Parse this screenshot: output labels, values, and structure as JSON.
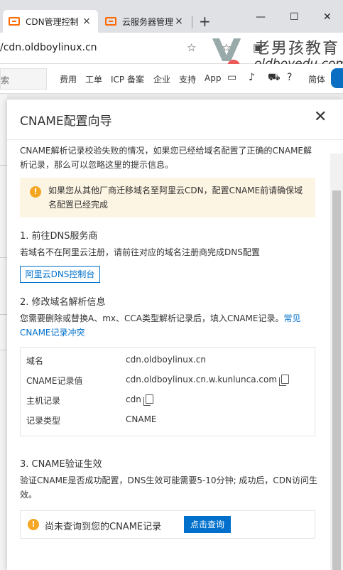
{
  "browser": {
    "tabs": [
      {
        "label": "CDN管理控制",
        "close": "×"
      },
      {
        "label": "云服务器管理",
        "close": "×"
      }
    ],
    "newtab": "+",
    "window_buttons": {
      "minimize": "—",
      "maximize": "☐",
      "close": "✕"
    },
    "url": "/cdn.oldboylinux.cn"
  },
  "watermark": {
    "title": "老男孩教育",
    "subtitle": "oldboyedu.com"
  },
  "site_nav": {
    "search_stub": "索",
    "items": [
      "费用",
      "工单",
      "ICP 备案",
      "企业",
      "支持",
      "App"
    ],
    "lang": "简体"
  },
  "drawer": {
    "title": "CNAME配置向导",
    "close": "✕",
    "intro": "CNAME解析记录校验失败的情况，如果您已经给域名配置了正确的CNAME解析记录，那么可以忽略这里的提示信息。",
    "notice": "如果您从其他厂商迁移域名至阿里云CDN，配置CNAME前请确保域名配置已经完成",
    "step1": {
      "title": "1. 前往DNS服务商",
      "desc": "若域名不在阿里云注册，请前往对应的域名注册商完成DNS配置",
      "button": "阿里云DNS控制台"
    },
    "step2": {
      "title": "2. 修改域名解析信息",
      "desc": "您需要删除或替换A、mx、CCA类型解析记录后，填入CNAME记录。",
      "link": "常见CNAME记录冲突",
      "rows": [
        {
          "key": "域名",
          "value": "cdn.oldboylinux.cn"
        },
        {
          "key": "CNAME记录值",
          "value": "cdn.oldboylinux.cn.w.kunlunca.com"
        },
        {
          "key": "主机记录",
          "value": "cdn"
        },
        {
          "key": "记录类型",
          "value": "CNAME"
        }
      ]
    },
    "step3": {
      "title": "3. CNAME验证生效",
      "desc": "验证CNAME是否成功配置，DNS生效可能需要5-10分钟; 成功后，CDN访问生效。",
      "status": "尚未查询到您的CNAME记录",
      "button": "点击查询"
    }
  }
}
